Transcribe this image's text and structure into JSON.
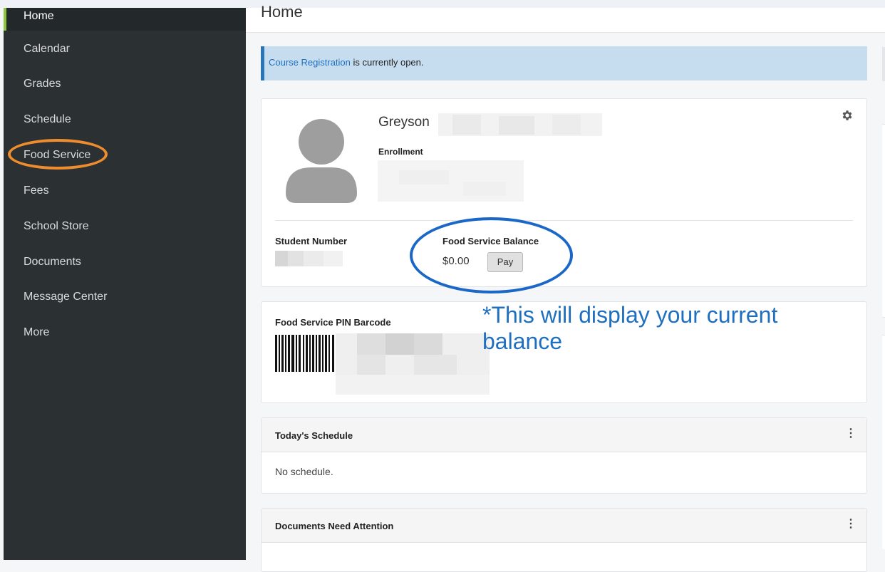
{
  "sidebar": {
    "items": [
      {
        "label": "Home"
      },
      {
        "label": "Calendar"
      },
      {
        "label": "Grades"
      },
      {
        "label": "Schedule"
      },
      {
        "label": "Food Service"
      },
      {
        "label": "Fees"
      },
      {
        "label": "School Store"
      },
      {
        "label": "Documents"
      },
      {
        "label": "Message Center"
      },
      {
        "label": "More"
      }
    ]
  },
  "header": {
    "title": "Home"
  },
  "alert": {
    "link_text": "Course Registration",
    "text": " is currently open."
  },
  "profile": {
    "first_name": "Greyson",
    "enrollment_label": "Enrollment",
    "student_number_label": "Student Number",
    "food_balance_label": "Food Service Balance",
    "food_balance_value": "$0.00",
    "pay_label": "Pay",
    "settings_icon": "gear-icon"
  },
  "barcode_card": {
    "title": "Food Service PIN Barcode"
  },
  "annotation": {
    "text": "*This will display your current balance"
  },
  "schedule_card": {
    "title": "Today's Schedule",
    "empty_text": "No schedule.",
    "menu_icon": "kebab-menu-icon"
  },
  "documents_card": {
    "title": "Documents Need Attention",
    "menu_icon": "kebab-menu-icon"
  },
  "colors": {
    "sidebar_bg": "#2b3033",
    "active_accent": "#8cc63f",
    "link_blue": "#1f6fc1",
    "alert_bg": "#c6ddf0",
    "orange_highlight": "#ef8d2e",
    "blue_highlight": "#1a67c8"
  }
}
